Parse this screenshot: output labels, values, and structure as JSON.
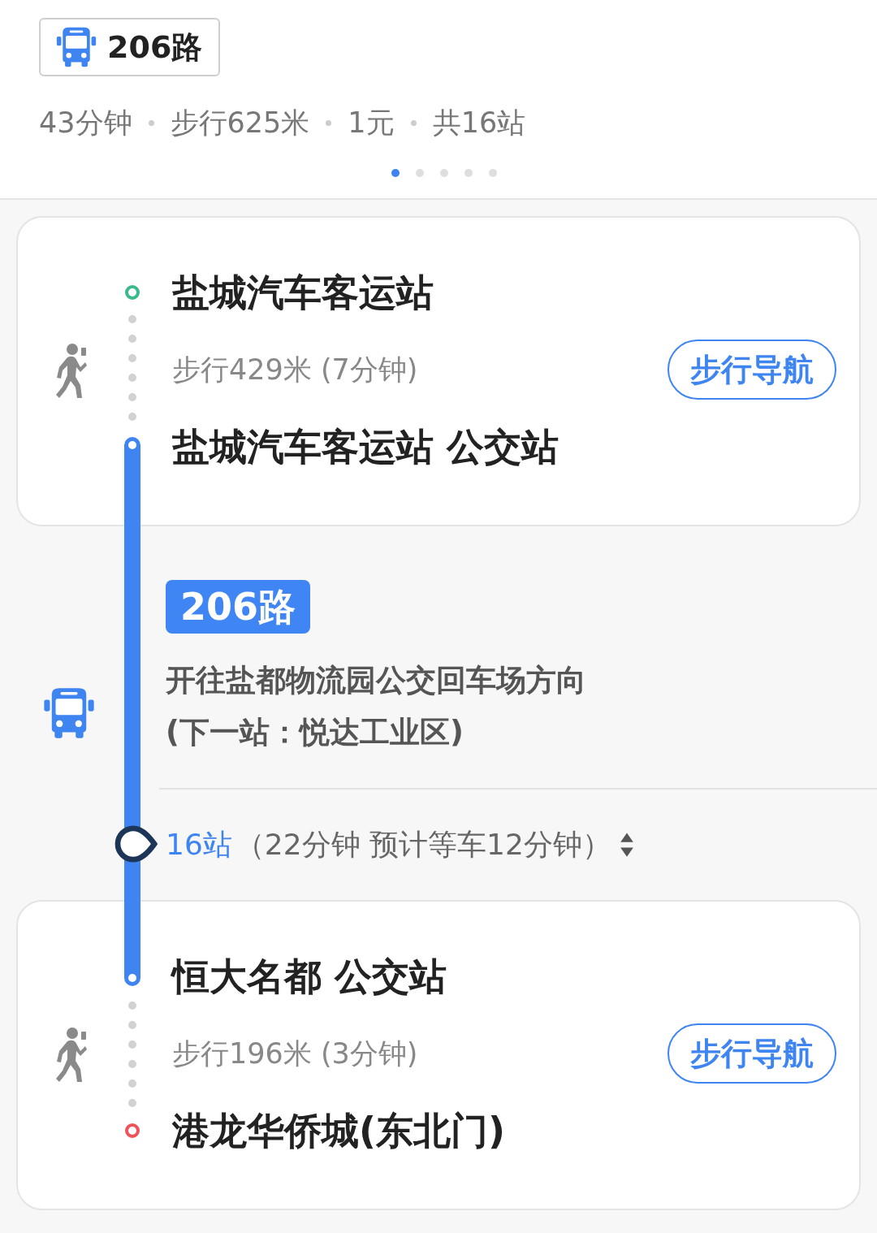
{
  "route_chip": {
    "label": "206路"
  },
  "summary": [
    "43分钟",
    "步行625米",
    "1元",
    "共16站"
  ],
  "pager": [
    {
      "selected": true
    },
    {
      "selected": false
    },
    {
      "selected": false
    },
    {
      "selected": false
    },
    {
      "selected": false
    }
  ],
  "segments": [
    {
      "kind": "walk",
      "start_marker": {
        "kind": "origin"
      },
      "from": "盐城汽车客运站",
      "distance": "步行429米 (7分钟)",
      "nav_button": "步行导航",
      "end_marker": {
        "kind": "bus"
      },
      "to": "盐城汽车客运站 公交站"
    },
    {
      "kind": "bus",
      "line": "206路",
      "direction": "开往盐都物流园公交回车场方向",
      "next_stop": "(下一站：悦达工业区)",
      "stops": "16站",
      "duration": "（22分钟 预计等车12分钟）"
    },
    {
      "kind": "walk",
      "start_marker": {
        "kind": "bus"
      },
      "from": "恒大名都 公交站",
      "distance": "步行196米 (3分钟)",
      "nav_button": "步行导航",
      "end_marker": {
        "kind": "destination"
      },
      "to": "港龙华侨城(东北门)"
    }
  ]
}
